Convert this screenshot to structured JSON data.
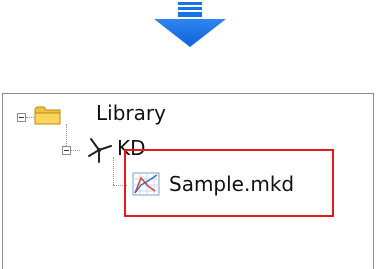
{
  "arrow": {
    "icon": "down-arrow-icon",
    "color": "#1673e8"
  },
  "tree": {
    "nodes": [
      {
        "label": "Library",
        "icon": "folder-icon",
        "expanded": true
      },
      {
        "label": "KD",
        "icon": "turbine-icon",
        "expanded": true
      },
      {
        "label": "Sample.mkd",
        "icon": "chart-file-icon"
      }
    ]
  },
  "highlight": {
    "color": "#e21b1b"
  }
}
